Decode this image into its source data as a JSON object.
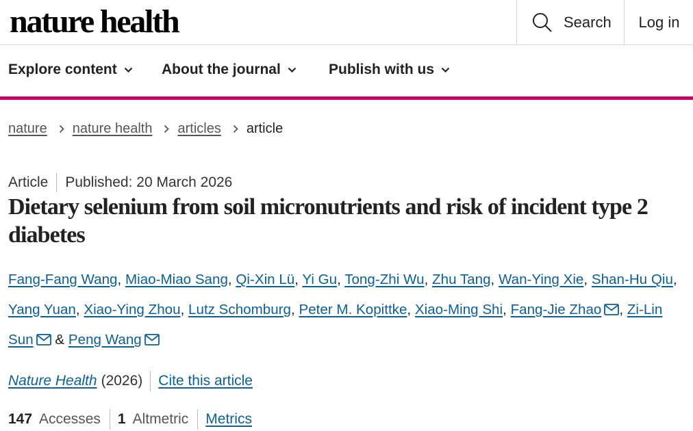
{
  "header": {
    "logo_text": "nature health",
    "search_label": "Search",
    "login_label": "Log in"
  },
  "nav": {
    "items": [
      {
        "label": "Explore content"
      },
      {
        "label": "About the journal"
      },
      {
        "label": "Publish with us"
      }
    ],
    "accent_color": "#c8006a"
  },
  "breadcrumb": {
    "items": [
      "nature",
      "nature health",
      "articles"
    ],
    "current": "article"
  },
  "article": {
    "type": "Article",
    "published": "Published: 20 March 2026",
    "title": "Dietary selenium from soil micronutrients and risk of incident type 2 diabetes",
    "authors": [
      "Fang-Fang Wang",
      "Miao-Miao Sang",
      "Qi-Xin Lü",
      "Yi Gu",
      "Tong-Zhi Wu",
      "Zhu Tang",
      "Wan-Ying Xie",
      "Shan-Hu Qiu",
      "Yang Yuan",
      "Xiao-Ying Zhou",
      "Lutz Schomburg",
      "Peter M. Kopittke",
      "Xiao-Ming Shi",
      "Fang-Jie Zhao",
      "Zi-Lin Sun",
      "Peng Wang"
    ],
    "author_separator": ",",
    "last_separator": "&",
    "journal": "Nature Health",
    "year": "(2026)",
    "cite_label": "Cite this article",
    "metrics": {
      "accesses_value": "147",
      "accesses_label": "Accesses",
      "altmetric_value": "1",
      "altmetric_label": "Altmetric",
      "metrics_link": "Metrics"
    }
  },
  "icons": {
    "search": "search-icon",
    "chevron": "chevron-down-icon",
    "breadcrumb_separator": "chevron-right-icon",
    "email": "email-icon"
  },
  "colors": {
    "link": "#0f5f93",
    "text": "#222222"
  }
}
